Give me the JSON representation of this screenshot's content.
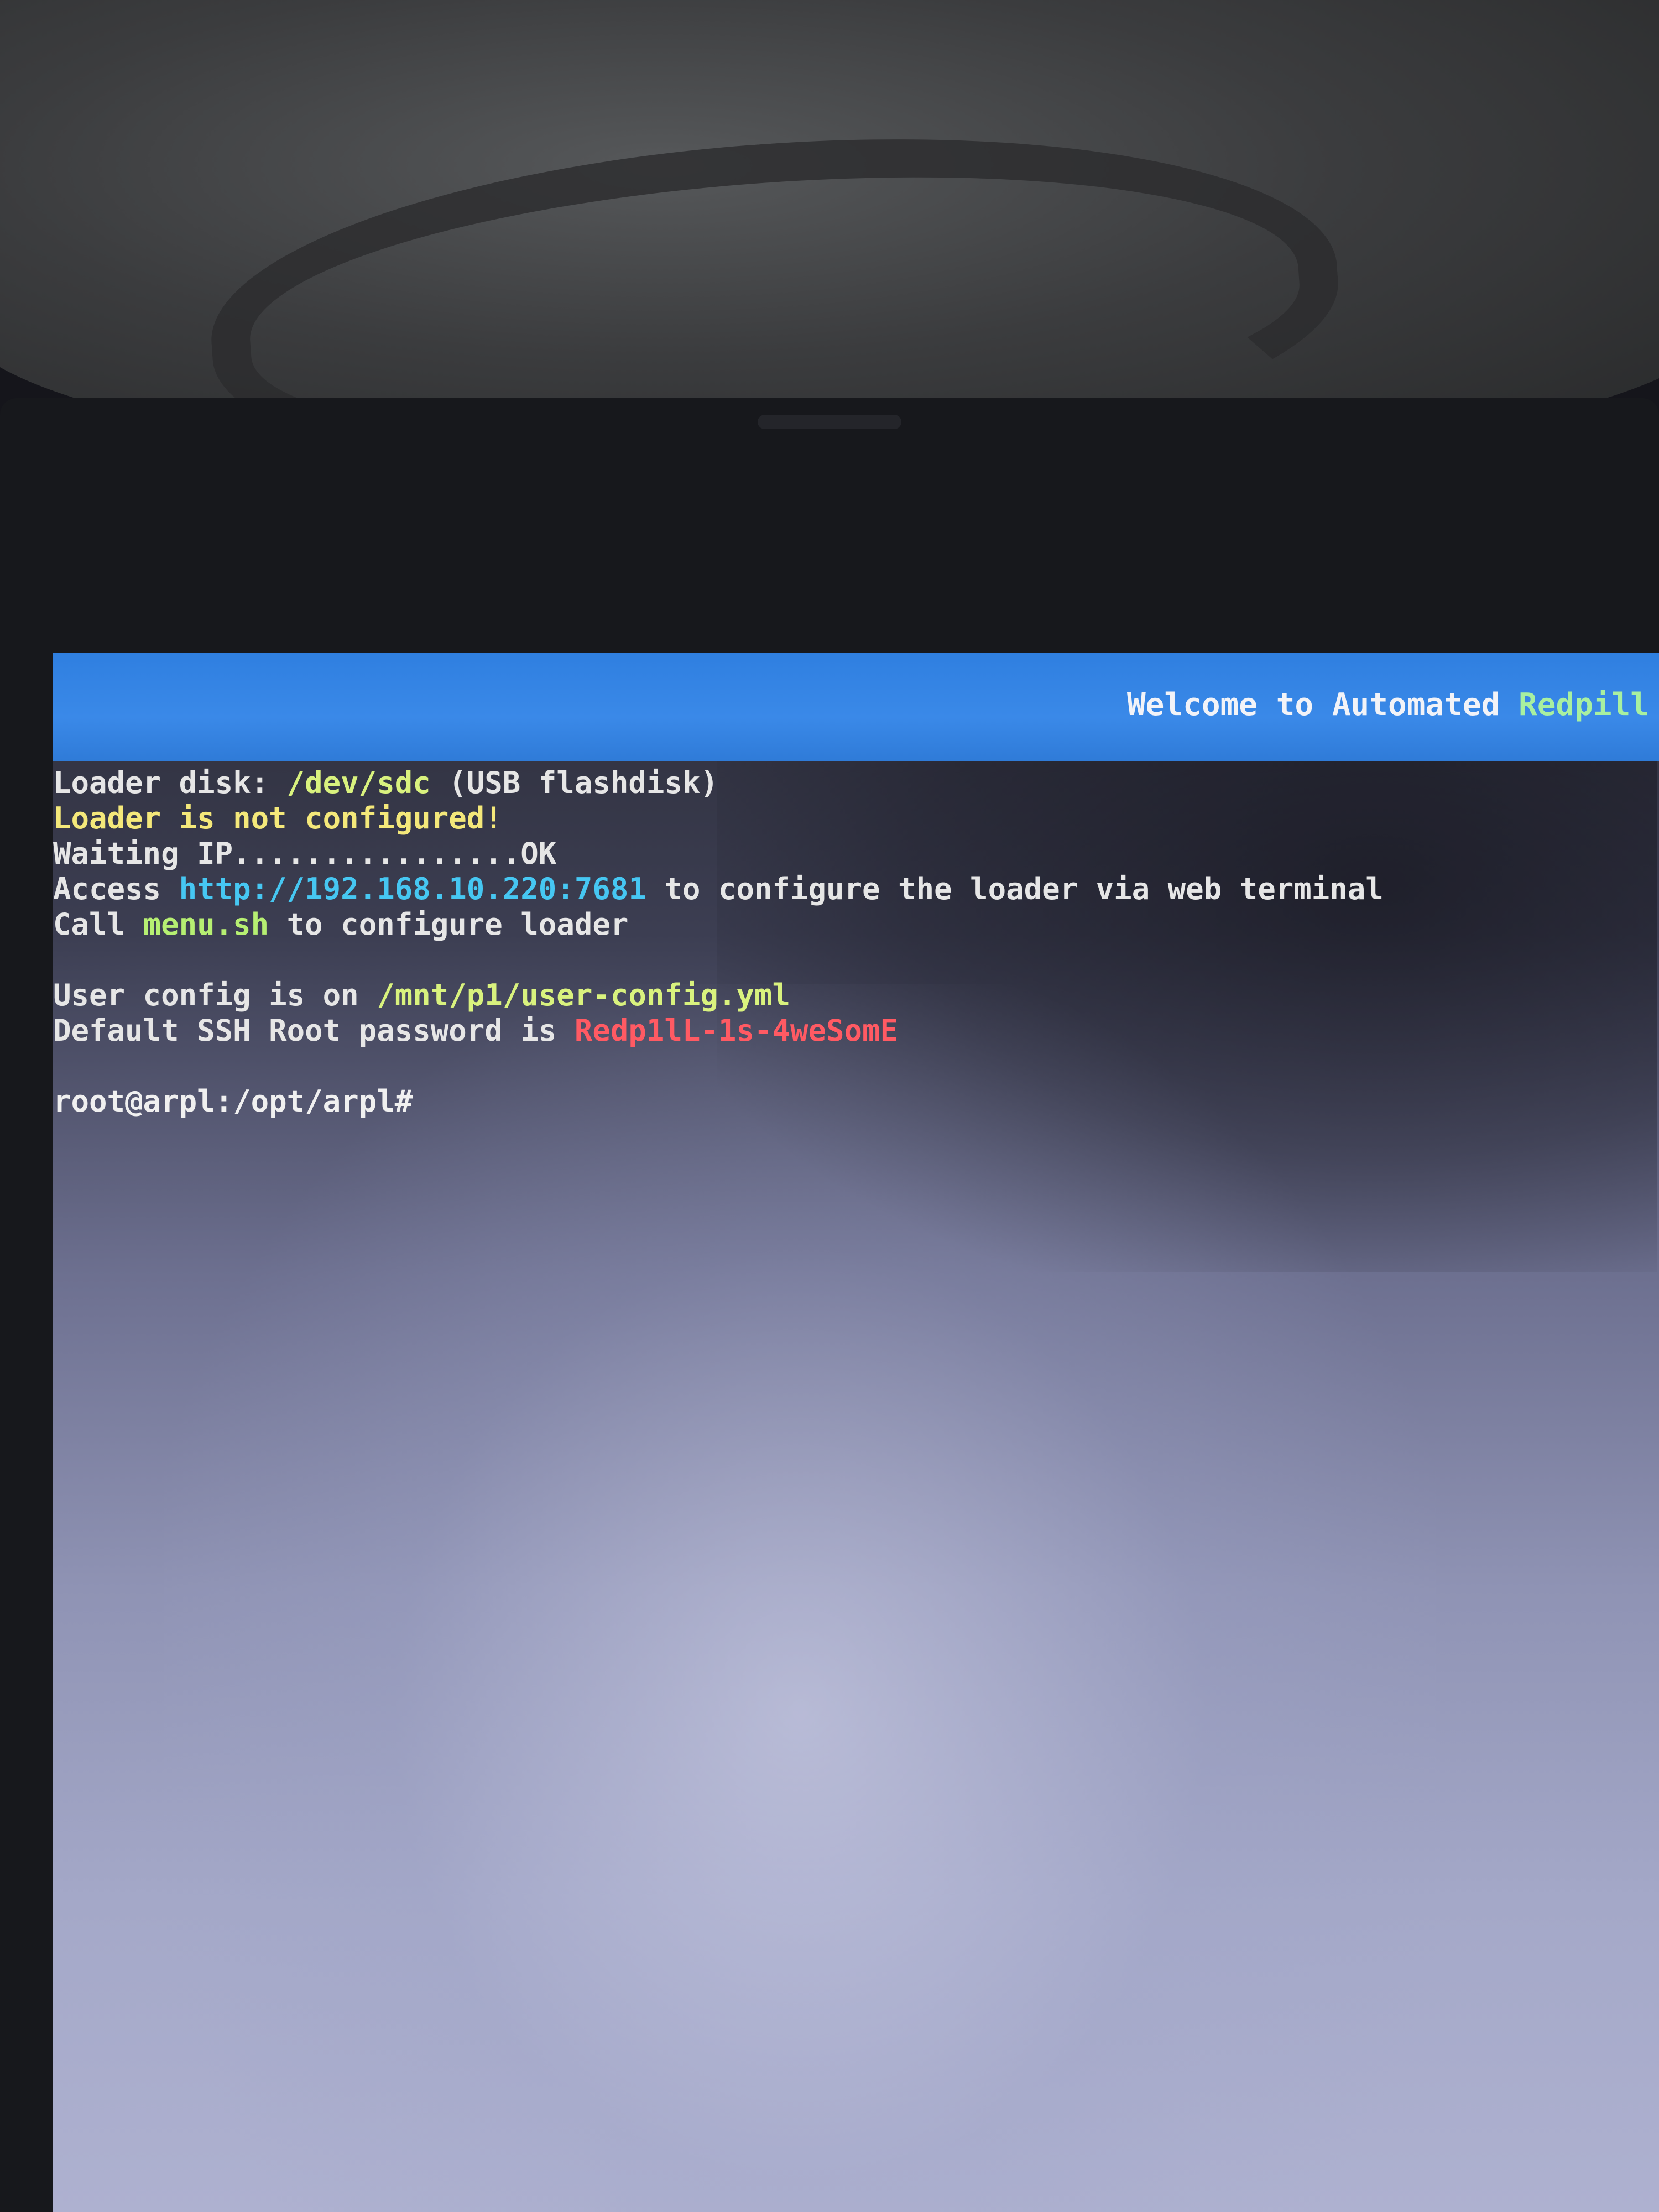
{
  "header": {
    "title_part1": "Welcome to Automated ",
    "title_part2": "Redpill"
  },
  "terminal": {
    "loader_disk": {
      "prefix": "Loader disk: ",
      "device": "/dev/sdc",
      "suffix": " (USB flashdisk)"
    },
    "not_configured": "Loader is not configured!",
    "waiting_ip": "Waiting IP................OK",
    "access": {
      "prefix": "Access ",
      "url": "http://192.168.10.220:7681",
      "suffix": " to configure the loader via web terminal"
    },
    "call": {
      "prefix": "Call ",
      "command": "menu.sh",
      "suffix": " to configure loader"
    },
    "user_config": {
      "prefix": "User config is on ",
      "path": "/mnt/p1/user-config.yml"
    },
    "ssh_password": {
      "prefix": "Default SSH Root password is ",
      "password": "Redp1lL-1s-4weSomE"
    },
    "prompt": "root@arpl:/opt/arpl#"
  },
  "colors": {
    "title_bar": "#3a89e8",
    "url": "#46c7f2",
    "warning": "#f4e87a",
    "password": "#ff5a63",
    "highlight": "#d9f27e"
  }
}
